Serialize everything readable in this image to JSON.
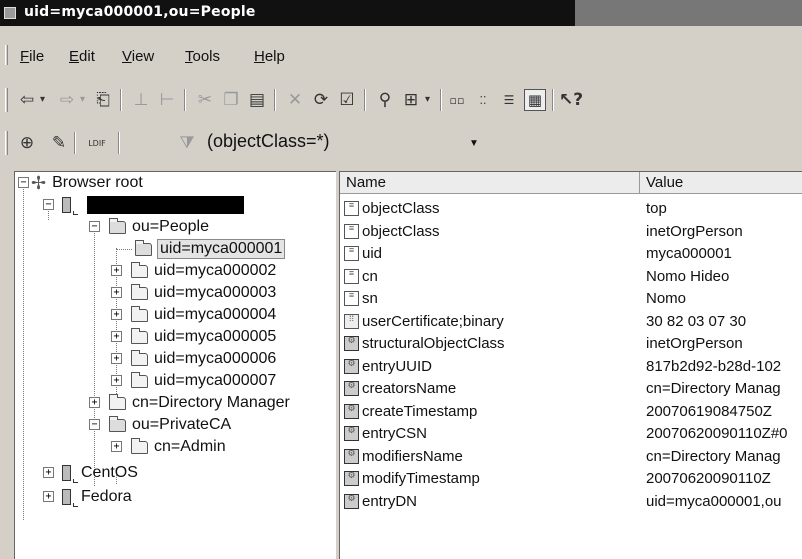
{
  "window": {
    "title": "uid=myca000001,ou=People"
  },
  "menu": [
    {
      "pre": "",
      "ul": "F",
      "post": "ile"
    },
    {
      "pre": "",
      "ul": "E",
      "post": "dit"
    },
    {
      "pre": "",
      "ul": "V",
      "post": "iew"
    },
    {
      "pre": "",
      "ul": "T",
      "post": "ools"
    },
    {
      "pre": "",
      "ul": "H",
      "post": "elp"
    }
  ],
  "filter": {
    "value": "(objectClass=*)",
    "ldif_label": "LDIF"
  },
  "tree": {
    "root": "Browser root",
    "people": "ou=People",
    "users": [
      "uid=myca000001",
      "uid=myca000002",
      "uid=myca000003",
      "uid=myca000004",
      "uid=myca000005",
      "uid=myca000006",
      "uid=myca000007"
    ],
    "manager": "cn=Directory Manager",
    "privateca": "ou=PrivateCA",
    "admin": "cn=Admin",
    "centos": "CentOS",
    "fedora": "Fedora"
  },
  "list": {
    "col_name": "Name",
    "col_value": "Value",
    "rows": [
      {
        "name": "objectClass",
        "value": "top",
        "icon": "list-icon"
      },
      {
        "name": "objectClass",
        "value": "inetOrgPerson",
        "icon": "list-icon"
      },
      {
        "name": "uid",
        "value": "myca000001",
        "icon": "list-icon"
      },
      {
        "name": "cn",
        "value": "Nomo Hideo",
        "icon": "list-icon"
      },
      {
        "name": "sn",
        "value": "Nomo",
        "icon": "list-icon"
      },
      {
        "name": "userCertificate;binary",
        "value": "30  82  03  07  30",
        "icon": "binary-icon"
      },
      {
        "name": "structuralObjectClass",
        "value": "inetOrgPerson",
        "icon": "system-attribute-icon"
      },
      {
        "name": "entryUUID",
        "value": "817b2d92-b28d-102",
        "icon": "system-attribute-icon"
      },
      {
        "name": "creatorsName",
        "value": "cn=Directory Manag",
        "icon": "system-attribute-icon"
      },
      {
        "name": "createTimestamp",
        "value": "20070619084750Z",
        "icon": "system-attribute-icon"
      },
      {
        "name": "entryCSN",
        "value": "20070620090110Z#0",
        "icon": "system-attribute-icon"
      },
      {
        "name": "modifiersName",
        "value": "cn=Directory Manag",
        "icon": "system-attribute-icon"
      },
      {
        "name": "modifyTimestamp",
        "value": "20070620090110Z",
        "icon": "system-attribute-icon"
      },
      {
        "name": "entryDN",
        "value": "uid=myca000001,ou",
        "icon": "system-attribute-icon"
      }
    ]
  }
}
